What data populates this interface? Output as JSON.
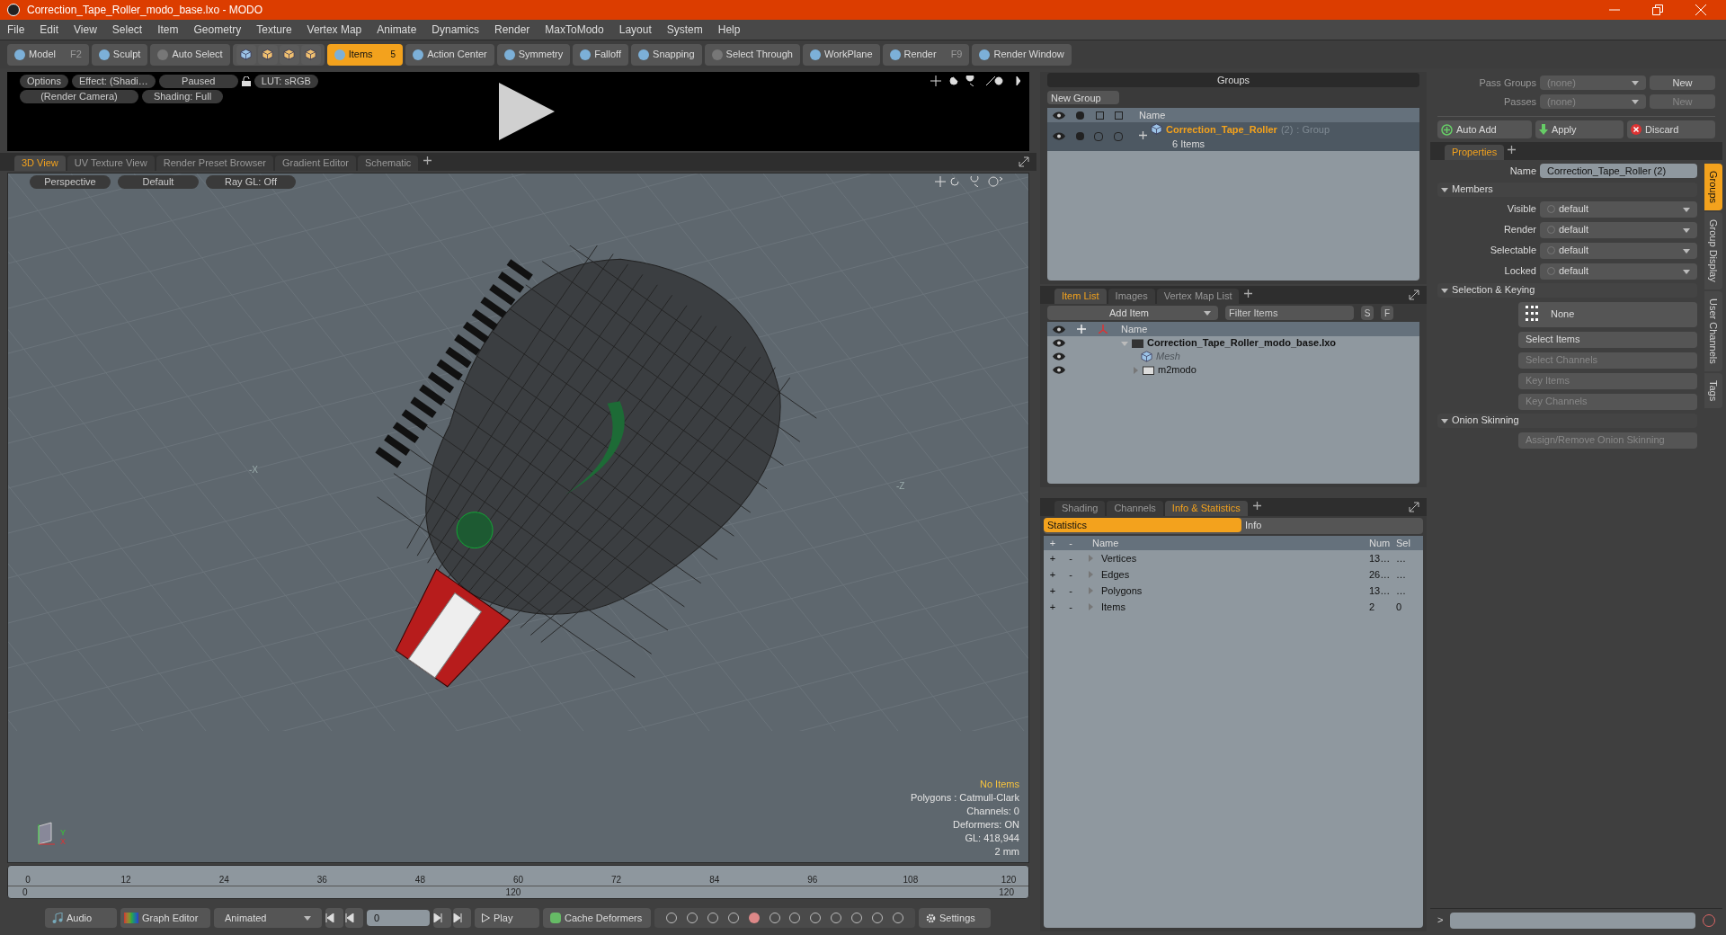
{
  "window": {
    "title": "Correction_Tape_Roller_modo_base.lxo - MODO"
  },
  "menu": [
    "File",
    "Edit",
    "View",
    "Select",
    "Item",
    "Geometry",
    "Texture",
    "Vertex Map",
    "Animate",
    "Dynamics",
    "Render",
    "MaxToModo",
    "Layout",
    "System",
    "Help"
  ],
  "toolbar": [
    {
      "kind": "mode",
      "label": "Model",
      "shortcut": "F2",
      "disabled": false,
      "selected": false
    },
    {
      "kind": "mode",
      "label": "Sculpt",
      "disabled": false,
      "selected": false
    },
    {
      "kind": "button",
      "label": "Auto Select",
      "disabled": true,
      "selected": false
    },
    {
      "kind": "icons"
    },
    {
      "kind": "button",
      "label": "Items",
      "badge": "5",
      "disabled": false,
      "selected": true
    },
    {
      "kind": "button",
      "label": "Action Center",
      "disabled": false,
      "selected": false
    },
    {
      "kind": "button",
      "label": "Symmetry",
      "disabled": false,
      "selected": false
    },
    {
      "kind": "button",
      "label": "Falloff",
      "disabled": false,
      "selected": false
    },
    {
      "kind": "button",
      "label": "Snapping",
      "disabled": false,
      "selected": false
    },
    {
      "kind": "button",
      "label": "Select Through",
      "disabled": true,
      "selected": false
    },
    {
      "kind": "button",
      "label": "WorkPlane",
      "disabled": false,
      "selected": false
    },
    {
      "kind": "button",
      "label": "Render",
      "shortcut": "F9",
      "disabled": false,
      "selected": false
    },
    {
      "kind": "button",
      "label": "Render Window",
      "disabled": false,
      "selected": false
    }
  ],
  "preview": {
    "row1": [
      "Options",
      "Effect: (Shadi…",
      "Paused",
      "LUT: sRGB"
    ],
    "row2": [
      "(Render Camera)",
      "Shading: Full"
    ]
  },
  "viewport_tabs": [
    {
      "label": "3D View",
      "selected": true
    },
    {
      "label": "UV Texture View",
      "selected": false
    },
    {
      "label": "Render Preset Browser",
      "selected": false
    },
    {
      "label": "Gradient Editor",
      "selected": false
    },
    {
      "label": "Schematic",
      "selected": false
    }
  ],
  "viewport": {
    "buttons": [
      "Perspective",
      "Default",
      "Ray GL: Off"
    ],
    "axis_labels": [
      "-X",
      "-Z"
    ],
    "gizmo_labels": [
      "Y",
      "X"
    ],
    "info": [
      {
        "text": "No Items",
        "highlight": true
      },
      {
        "text": "Polygons : Catmull-Clark",
        "highlight": false
      },
      {
        "text": "Channels: 0",
        "highlight": false
      },
      {
        "text": "Deformers: ON",
        "highlight": false
      },
      {
        "text": "GL: 418,944",
        "highlight": false
      },
      {
        "text": "2 mm",
        "highlight": false
      }
    ]
  },
  "timeline": {
    "ticks": [
      "0",
      "12",
      "24",
      "36",
      "48",
      "60",
      "72",
      "84",
      "96",
      "108",
      "120"
    ],
    "range_start": "0",
    "range_mid": "120",
    "range_end": "120"
  },
  "bottom_bar": {
    "audio": "Audio",
    "graph_editor": "Graph Editor",
    "mode": "Animated",
    "frame": "0",
    "play": "Play",
    "cache": "Cache Deformers",
    "settings": "Settings"
  },
  "groups": {
    "title": "Groups",
    "new_group": "New Group",
    "column": "Name",
    "rows": [
      {
        "name": "Correction_Tape_Roller",
        "count": "(2)",
        "type": ": Group",
        "sub": "6 Items",
        "selected": true
      }
    ]
  },
  "item_list": {
    "tabs": [
      {
        "label": "Item List",
        "selected": true
      },
      {
        "label": "Images",
        "selected": false
      },
      {
        "label": "Vertex Map List",
        "selected": false
      }
    ],
    "add_item": "Add Item",
    "filter_placeholder": "Filter Items",
    "s": "S",
    "f": "F",
    "column": "Name",
    "tree": [
      {
        "name": "Correction_Tape_Roller_modo_base.lxo",
        "kind": "scene",
        "expanded": true,
        "disabled": false,
        "children": [
          {
            "name": "Mesh",
            "kind": "mesh",
            "disabled": true
          },
          {
            "name": "m2modo",
            "kind": "folder",
            "expanded": false,
            "disabled": false
          }
        ]
      }
    ]
  },
  "info_panel": {
    "tabs": [
      {
        "label": "Shading",
        "selected": false
      },
      {
        "label": "Channels",
        "selected": false
      },
      {
        "label": "Info & Statistics",
        "selected": true
      }
    ],
    "subtabs": [
      {
        "label": "Statistics",
        "selected": true
      },
      {
        "label": "Info",
        "selected": false
      }
    ],
    "columns": [
      "+",
      "-",
      "Name",
      "Num",
      "Sel"
    ],
    "rows": [
      {
        "plus": "+",
        "minus": "-",
        "name": "Vertices",
        "num": "13…",
        "sel": "…"
      },
      {
        "plus": "+",
        "minus": "-",
        "name": "Edges",
        "num": "26…",
        "sel": "…"
      },
      {
        "plus": "+",
        "minus": "-",
        "name": "Polygons",
        "num": "13…",
        "sel": "…"
      },
      {
        "plus": "+",
        "minus": "-",
        "name": "Items",
        "num": "2",
        "sel": "0"
      }
    ]
  },
  "passes": {
    "pass_groups_label": "Pass Groups",
    "pass_groups_value": "(none)",
    "new1": "New",
    "passes_label": "Passes",
    "passes_value": "(none)",
    "new2": "New",
    "auto_add": "Auto Add",
    "apply": "Apply",
    "discard": "Discard"
  },
  "properties": {
    "tab": "Properties",
    "name_label": "Name",
    "name_value": "Correction_Tape_Roller (2)",
    "sections": [
      {
        "title": "Members",
        "kind": "fields",
        "fields": [
          {
            "label": "Visible",
            "value": "default"
          },
          {
            "label": "Render",
            "value": "default"
          },
          {
            "label": "Selectable",
            "value": "default"
          },
          {
            "label": "Locked",
            "value": "default"
          }
        ]
      },
      {
        "title": "Selection & Keying",
        "kind": "buttons",
        "buttons": [
          {
            "label": "None",
            "kind": "big",
            "disabled": false
          },
          {
            "label": "Select Items",
            "kind": "plain",
            "disabled": false
          },
          {
            "label": "Select Channels",
            "kind": "plain",
            "disabled": true
          },
          {
            "label": "Key Items",
            "kind": "plain",
            "disabled": true
          },
          {
            "label": "Key Channels",
            "kind": "plain",
            "disabled": true
          }
        ]
      },
      {
        "title": "Onion Skinning",
        "kind": "buttons",
        "buttons": [
          {
            "label": "Assign/Remove Onion Skinning",
            "kind": "plain",
            "disabled": true
          }
        ]
      }
    ],
    "side_tabs": [
      {
        "label": "Groups",
        "selected": true
      },
      {
        "label": "Group Display",
        "selected": false
      },
      {
        "label": "User Channels",
        "selected": false
      },
      {
        "label": "Tags",
        "selected": false
      }
    ]
  },
  "command": {
    "prompt": ">"
  }
}
